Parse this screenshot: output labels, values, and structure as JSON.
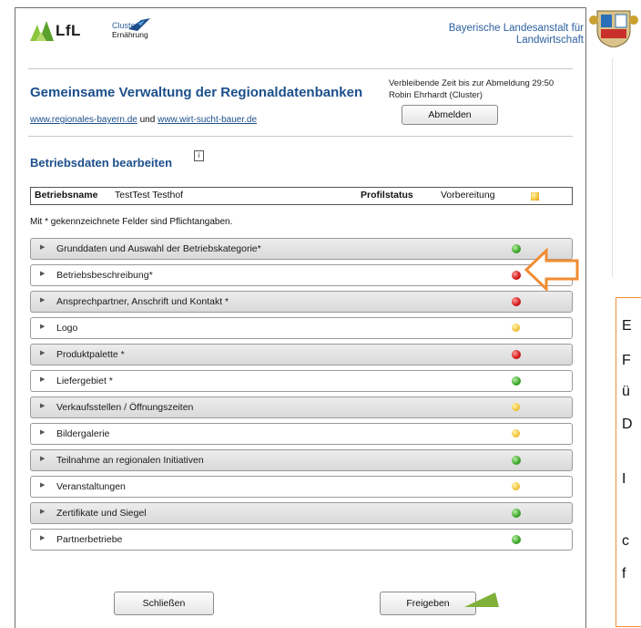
{
  "header": {
    "logo_text": "LfL",
    "cluster_line1": "Cluster",
    "cluster_line2": "Ernährung",
    "bavarian_line1": "Bayerische Landesanstalt für",
    "bavarian_line2": "Landwirtschaft"
  },
  "title": {
    "main": "Gemeinsame Verwaltung der Regionaldatenbanken",
    "link1": "www.regionales-bayern.de",
    "link_joiner": " und ",
    "link2": "www.wirt-sucht-bauer.de"
  },
  "session": {
    "timeout_text": "Verbleibende Zeit bis zur Abmeldung 29:50",
    "user_text": "Robin Ehrhardt  (Cluster)",
    "logout_label": "Abmelden"
  },
  "section": {
    "title": "Betriebsdaten bearbeiten",
    "info_glyph": "i"
  },
  "profile": {
    "name_label": "Betriebsname",
    "name_value": "TestTest Testhof",
    "status_label": "Profilstatus",
    "status_value": "Vorbereitung"
  },
  "required_note": "Mit * gekennzeichnete Felder sind Pflichtangaben.",
  "sections": [
    {
      "label": "Grunddaten und Auswahl der Betriebskategorie*",
      "status": "green"
    },
    {
      "label": "Betriebsbeschreibung*",
      "status": "red"
    },
    {
      "label": "Ansprechpartner, Anschrift und Kontakt *",
      "status": "red"
    },
    {
      "label": "Logo",
      "status": "yellow"
    },
    {
      "label": "Produktpalette *",
      "status": "red"
    },
    {
      "label": "Liefergebiet *",
      "status": "green"
    },
    {
      "label": "Verkaufsstellen / Öffnungszeiten",
      "status": "yellow"
    },
    {
      "label": "Bildergalerie",
      "status": "yellow"
    },
    {
      "label": "Teilnahme an regionalen Initiativen",
      "status": "green"
    },
    {
      "label": "Veranstaltungen",
      "status": "yellow"
    },
    {
      "label": "Zertifikate und Siegel",
      "status": "green"
    },
    {
      "label": "Partnerbetriebe",
      "status": "green"
    }
  ],
  "footer": {
    "close_label": "Schließen",
    "release_label": "Freigeben"
  },
  "side_note": {
    "letters": [
      "E",
      "F",
      "ü",
      "D",
      "I",
      "c",
      "f"
    ]
  },
  "colors": {
    "accent_blue": "#1c4f8b",
    "highlight_orange": "#f08c33",
    "status_green": "#3aa52a",
    "status_red": "#d21515",
    "status_yellow": "#f2c43a"
  }
}
